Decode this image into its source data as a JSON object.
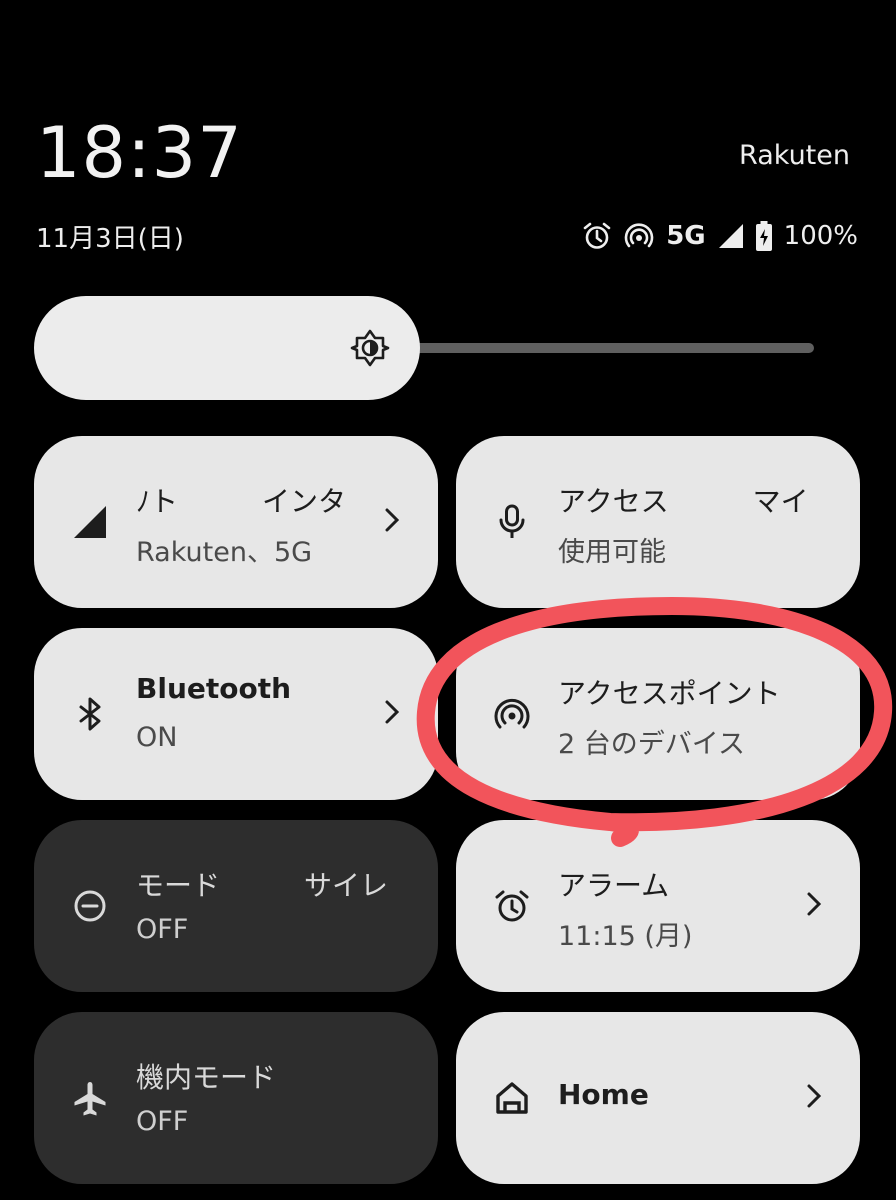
{
  "header": {
    "time": "18:37",
    "carrier": "Rakuten",
    "date": "11月3日(日)",
    "network_type": "5G",
    "battery": "100%"
  },
  "status_icons": [
    "alarm-icon",
    "hotspot-icon",
    "signal-icon",
    "battery-charging-icon"
  ],
  "brightness": {
    "icon": "brightness-icon",
    "level": 0.42
  },
  "tiles": [
    {
      "name": "mobile-data",
      "title": "ﾉト　　　インタ",
      "subtitle": "Rakuten、5G",
      "state": "on",
      "icon": "signal-icon",
      "chevron": true
    },
    {
      "name": "mic-access",
      "title": "アクセス　　　マイ",
      "subtitle": "使用可能",
      "state": "on",
      "icon": "microphone-icon",
      "chevron": false
    },
    {
      "name": "bluetooth",
      "title": "Bluetooth",
      "subtitle": "ON",
      "state": "on",
      "icon": "bluetooth-icon",
      "chevron": true
    },
    {
      "name": "hotspot",
      "title": "アクセスポイント",
      "subtitle": "2 台のデバイス",
      "state": "on",
      "icon": "hotspot-icon",
      "chevron": false
    },
    {
      "name": "silent-mode",
      "title": "モード　　　サイレ",
      "subtitle": "OFF",
      "state": "off",
      "icon": "do-not-disturb-icon",
      "chevron": false
    },
    {
      "name": "alarm",
      "title": "アラーム",
      "subtitle": "11:15 (月)",
      "state": "on",
      "icon": "alarm-icon",
      "chevron": true
    },
    {
      "name": "airplane-mode",
      "title": "機内モード",
      "subtitle": "OFF",
      "state": "off",
      "icon": "airplane-icon",
      "chevron": false
    },
    {
      "name": "home",
      "title": "Home",
      "subtitle": "",
      "state": "on",
      "icon": "home-icon",
      "chevron": true
    }
  ],
  "colors": {
    "tile_on": "#e7e7e7",
    "tile_off": "#2d2d2d",
    "annotation": "#f2545b"
  }
}
